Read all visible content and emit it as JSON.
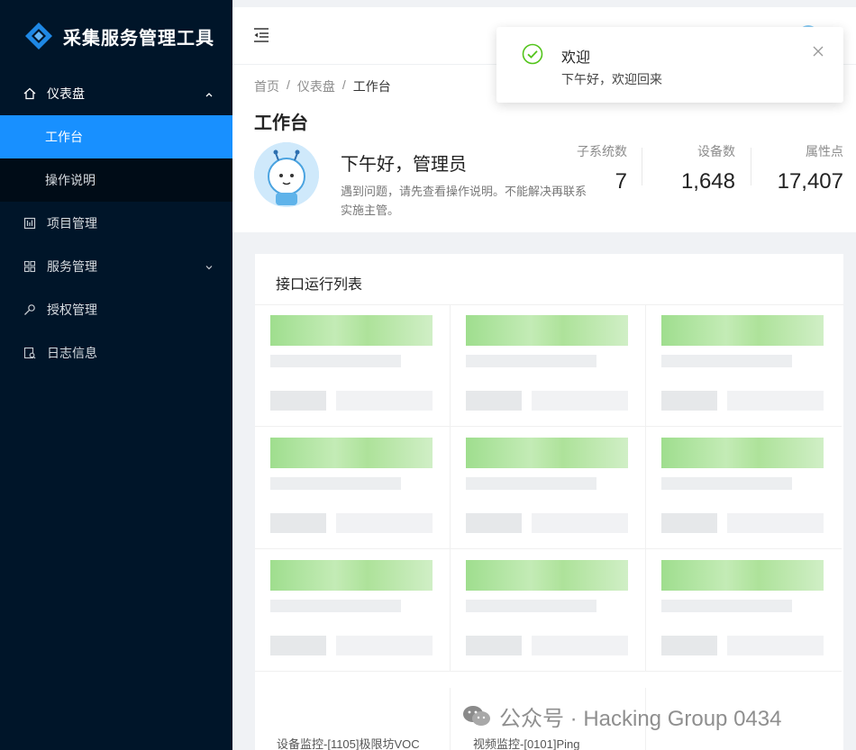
{
  "app": {
    "title": "采集服务管理工具"
  },
  "sidebar": {
    "items": [
      {
        "label": "仪表盘",
        "icon": "home-icon"
      },
      {
        "label": "工作台"
      },
      {
        "label": "操作说明"
      },
      {
        "label": "项目管理",
        "icon": "project-icon"
      },
      {
        "label": "服务管理",
        "icon": "apps-icon"
      },
      {
        "label": "授权管理",
        "icon": "key-icon"
      },
      {
        "label": "日志信息",
        "icon": "log-icon"
      }
    ]
  },
  "breadcrumb": [
    "首页",
    "仪表盘",
    "工作台"
  ],
  "page": {
    "title": "工作台",
    "greeting": "下午好，管理员",
    "subtext": "遇到问题，请先查看操作说明。不能解决再联系实施主管。"
  },
  "stats": [
    {
      "label": "子系统数",
      "value": "7"
    },
    {
      "label": "设备数",
      "value": "1,648"
    },
    {
      "label": "属性点",
      "value": "17,407"
    }
  ],
  "card": {
    "title": "接口运行列表",
    "last_row": [
      "设备监控-[1105]极限坊VOC",
      "视频监控-[0101]Ping"
    ]
  },
  "notification": {
    "title": "欢迎",
    "message": "下午好，欢迎回来"
  },
  "watermark": {
    "text": "公众号 · Hacking Group 0434"
  },
  "colors": {
    "sidebar_bg": "#001529",
    "active": "#1890ff",
    "success": "#52c41a"
  }
}
